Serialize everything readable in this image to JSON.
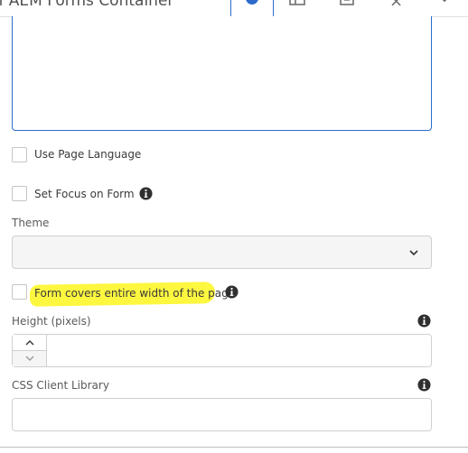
{
  "dialog": {
    "title": "of AEM Forms Container"
  },
  "toolbar": {
    "close_glyph": "×"
  },
  "options": {
    "use_page_language": "Use Page Language",
    "set_focus_on_form": "Set Focus on Form",
    "form_covers_width": "Form covers entire width of the page"
  },
  "fields": {
    "theme_label": "Theme",
    "height_label": "Height (pixels)",
    "css_client_library_label": "CSS Client Library"
  },
  "colors": {
    "accent": "#2c6bc9",
    "highlight": "#fdf740"
  },
  "icons": [
    "info-icon",
    "chevron-down-icon",
    "chevron-up-icon",
    "close-icon"
  ]
}
